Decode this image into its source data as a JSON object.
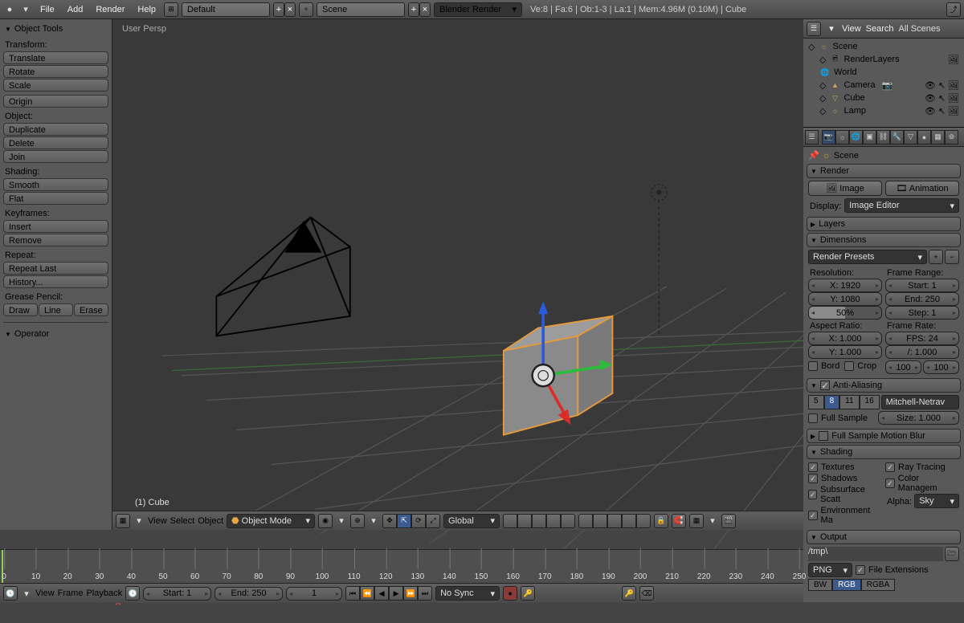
{
  "topbar": {
    "menus": [
      "File",
      "Add",
      "Render",
      "Help"
    ],
    "layout": "Default",
    "scene": "Scene",
    "engine": "Blender Render",
    "stats": "Ve:8 | Fa:6 | Ob:1-3 | La:1 | Mem:4.96M (0.10M) | Cube"
  },
  "toolbox": {
    "title": "Object Tools",
    "transform_label": "Transform:",
    "translate": "Translate",
    "rotate": "Rotate",
    "scale": "Scale",
    "origin": "Origin",
    "object_label": "Object:",
    "duplicate": "Duplicate",
    "delete": "Delete",
    "join": "Join",
    "shading_label": "Shading:",
    "smooth": "Smooth",
    "flat": "Flat",
    "keyframes_label": "Keyframes:",
    "insert": "Insert",
    "remove": "Remove",
    "repeat_label": "Repeat:",
    "repeat_last": "Repeat Last",
    "history": "History...",
    "gpencil_label": "Grease Pencil:",
    "draw": "Draw",
    "line": "Line",
    "erase": "Erase",
    "operator": "Operator"
  },
  "viewport": {
    "persp": "User Persp",
    "object_info": "(1) Cube",
    "menus": [
      "View",
      "Select",
      "Object"
    ],
    "mode": "Object Mode",
    "orientation": "Global"
  },
  "timeline": {
    "menus": [
      "View",
      "Frame",
      "Playback"
    ],
    "start_label": "Start: 1",
    "end_label": "End: 250",
    "current": "1",
    "sync": "No Sync",
    "ticks": [
      0,
      10,
      20,
      30,
      40,
      50,
      60,
      70,
      80,
      90,
      100,
      110,
      120,
      130,
      140,
      150,
      160,
      170,
      180,
      190,
      200,
      210,
      220,
      230,
      240,
      250
    ]
  },
  "outliner": {
    "menus": [
      "View",
      "Search"
    ],
    "filter": "All Scenes",
    "scene": "Scene",
    "renderlayers": "RenderLayers",
    "world": "World",
    "camera": "Camera",
    "cube": "Cube",
    "lamp": "Lamp"
  },
  "props": {
    "breadcrumb": "Scene",
    "render_panel": "Render",
    "image_btn": "Image",
    "animation_btn": "Animation",
    "display_label": "Display:",
    "display_value": "Image Editor",
    "layers_panel": "Layers",
    "dimensions_panel": "Dimensions",
    "render_presets": "Render Presets",
    "resolution_label": "Resolution:",
    "res_x": "X: 1920",
    "res_y": "Y: 1080",
    "res_pct": "50%",
    "framerange_label": "Frame Range:",
    "fr_start": "Start: 1",
    "fr_end": "End: 250",
    "fr_step": "Step: 1",
    "aspect_label": "Aspect Ratio:",
    "asp_x": "X: 1.000",
    "asp_y": "Y: 1.000",
    "bord": "Bord",
    "crop": "Crop",
    "framerate_label": "Frame Rate:",
    "fps": "FPS: 24",
    "fps_base": "/: 1.000",
    "tm_old": "100",
    "tm_new": "100",
    "aa_panel": "Anti-Aliasing",
    "aa_5": "5",
    "aa_8": "8",
    "aa_11": "11",
    "aa_16": "16",
    "aa_filter": "Mitchell-Netrav",
    "full_sample": "Full Sample",
    "aa_size": "Size: 1.000",
    "motion_blur": "Full Sample Motion Blur",
    "shading_panel": "Shading",
    "sh_tex": "Textures",
    "sh_ray": "Ray Tracing",
    "sh_shad": "Shadows",
    "sh_cm": "Color Managem",
    "sh_sss": "Subsurface Scatt",
    "sh_env": "Environment Ma",
    "alpha_label": "Alpha:",
    "alpha_value": "Sky",
    "output_panel": "Output",
    "out_path": "/tmp\\",
    "out_format": "PNG",
    "out_bw": "BW",
    "out_rgb": "RGB",
    "out_rgba": "RGBA",
    "file_ext": "File Extensions"
  }
}
